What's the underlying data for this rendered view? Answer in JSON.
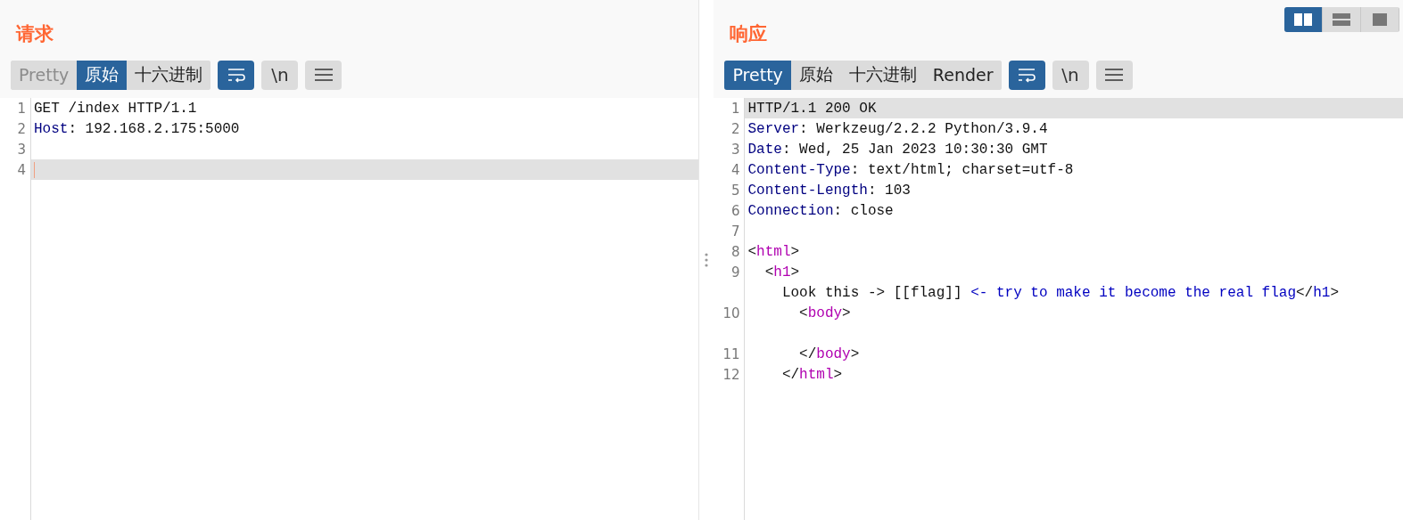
{
  "layout_buttons": [
    {
      "kind": "split",
      "selected": true
    },
    {
      "kind": "stacked",
      "selected": false
    },
    {
      "kind": "single",
      "selected": false
    }
  ],
  "panels": [
    {
      "title": "请求",
      "tabs": [
        {
          "label": "Pretty",
          "selected": false,
          "disabled": true
        },
        {
          "label": "原始",
          "selected": true,
          "disabled": false
        },
        {
          "label": "十六进制",
          "selected": false,
          "disabled": false
        }
      ],
      "toggles": [
        {
          "kind": "wrap",
          "on": true
        },
        {
          "kind": "newline",
          "label": "\\n",
          "on": false
        },
        {
          "kind": "menu",
          "on": false
        }
      ],
      "rows": [
        {
          "number": "1",
          "current": false,
          "caret": false,
          "segments": [
            {
              "kind": "text",
              "text": "GET /index HTTP/1.1"
            }
          ]
        },
        {
          "number": "2",
          "current": false,
          "caret": false,
          "segments": [
            {
              "kind": "name",
              "text": "Host"
            },
            {
              "kind": "text",
              "text": ": 192.168.2.175:5000"
            }
          ]
        },
        {
          "number": "3",
          "current": false,
          "caret": false,
          "segments": []
        },
        {
          "number": "4",
          "current": true,
          "caret": true,
          "segments": []
        }
      ]
    },
    {
      "title": "响应",
      "tabs": [
        {
          "label": "Pretty",
          "selected": true,
          "disabled": false
        },
        {
          "label": "原始",
          "selected": false,
          "disabled": false
        },
        {
          "label": "十六进制",
          "selected": false,
          "disabled": false
        },
        {
          "label": "Render",
          "selected": false,
          "disabled": false
        }
      ],
      "toggles": [
        {
          "kind": "wrap",
          "on": true
        },
        {
          "kind": "newline",
          "label": "\\n",
          "on": false
        },
        {
          "kind": "menu",
          "on": false
        }
      ],
      "rows": [
        {
          "number": "1",
          "current": true,
          "caret": false,
          "segments": [
            {
              "kind": "text",
              "text": "HTTP/1.1 200 OK"
            }
          ]
        },
        {
          "number": "2",
          "current": false,
          "caret": false,
          "segments": [
            {
              "kind": "name",
              "text": "Server"
            },
            {
              "kind": "text",
              "text": ": Werkzeug/2.2.2 Python/3.9.4"
            }
          ]
        },
        {
          "number": "3",
          "current": false,
          "caret": false,
          "segments": [
            {
              "kind": "name",
              "text": "Date"
            },
            {
              "kind": "text",
              "text": ": Wed, 25 Jan 2023 10:30:30 GMT"
            }
          ]
        },
        {
          "number": "4",
          "current": false,
          "caret": false,
          "segments": [
            {
              "kind": "name",
              "text": "Content-Type"
            },
            {
              "kind": "text",
              "text": ": text/html; charset=utf-8"
            }
          ]
        },
        {
          "number": "5",
          "current": false,
          "caret": false,
          "segments": [
            {
              "kind": "name",
              "text": "Content-Length"
            },
            {
              "kind": "text",
              "text": ": 103"
            }
          ]
        },
        {
          "number": "6",
          "current": false,
          "caret": false,
          "segments": [
            {
              "kind": "name",
              "text": "Connection"
            },
            {
              "kind": "text",
              "text": ": close"
            }
          ]
        },
        {
          "number": "7",
          "current": false,
          "caret": false,
          "segments": []
        },
        {
          "number": "8",
          "current": false,
          "caret": false,
          "segments": [
            {
              "kind": "text",
              "text": "<"
            },
            {
              "kind": "tag",
              "text": "html"
            },
            {
              "kind": "text",
              "text": ">"
            }
          ]
        },
        {
          "number": "9",
          "current": false,
          "caret": false,
          "segments": [
            {
              "kind": "text",
              "text": "  <"
            },
            {
              "kind": "tag",
              "text": "h1"
            },
            {
              "kind": "text",
              "text": ">"
            }
          ]
        },
        {
          "current": false,
          "caret": false,
          "segments": [
            {
              "kind": "text",
              "text": "    Look this -> [[flag]] "
            },
            {
              "kind": "comment",
              "text": "<- try to make it become the real flag"
            },
            {
              "kind": "text",
              "text": "</"
            },
            {
              "kind": "comment",
              "text": "h1"
            },
            {
              "kind": "text",
              "text": ">"
            }
          ]
        },
        {
          "number": "10",
          "current": false,
          "caret": false,
          "segments": [
            {
              "kind": "text",
              "text": "      <"
            },
            {
              "kind": "tag",
              "text": "body"
            },
            {
              "kind": "text",
              "text": ">"
            }
          ]
        },
        {
          "current": false,
          "caret": false,
          "segments": []
        },
        {
          "number": "11",
          "current": false,
          "caret": false,
          "segments": [
            {
              "kind": "text",
              "text": "      </"
            },
            {
              "kind": "tag",
              "text": "body"
            },
            {
              "kind": "text",
              "text": ">"
            }
          ]
        },
        {
          "number": "12",
          "current": false,
          "caret": false,
          "segments": [
            {
              "kind": "text",
              "text": "    </"
            },
            {
              "kind": "tag",
              "text": "html"
            },
            {
              "kind": "text",
              "text": ">"
            }
          ]
        }
      ]
    }
  ]
}
